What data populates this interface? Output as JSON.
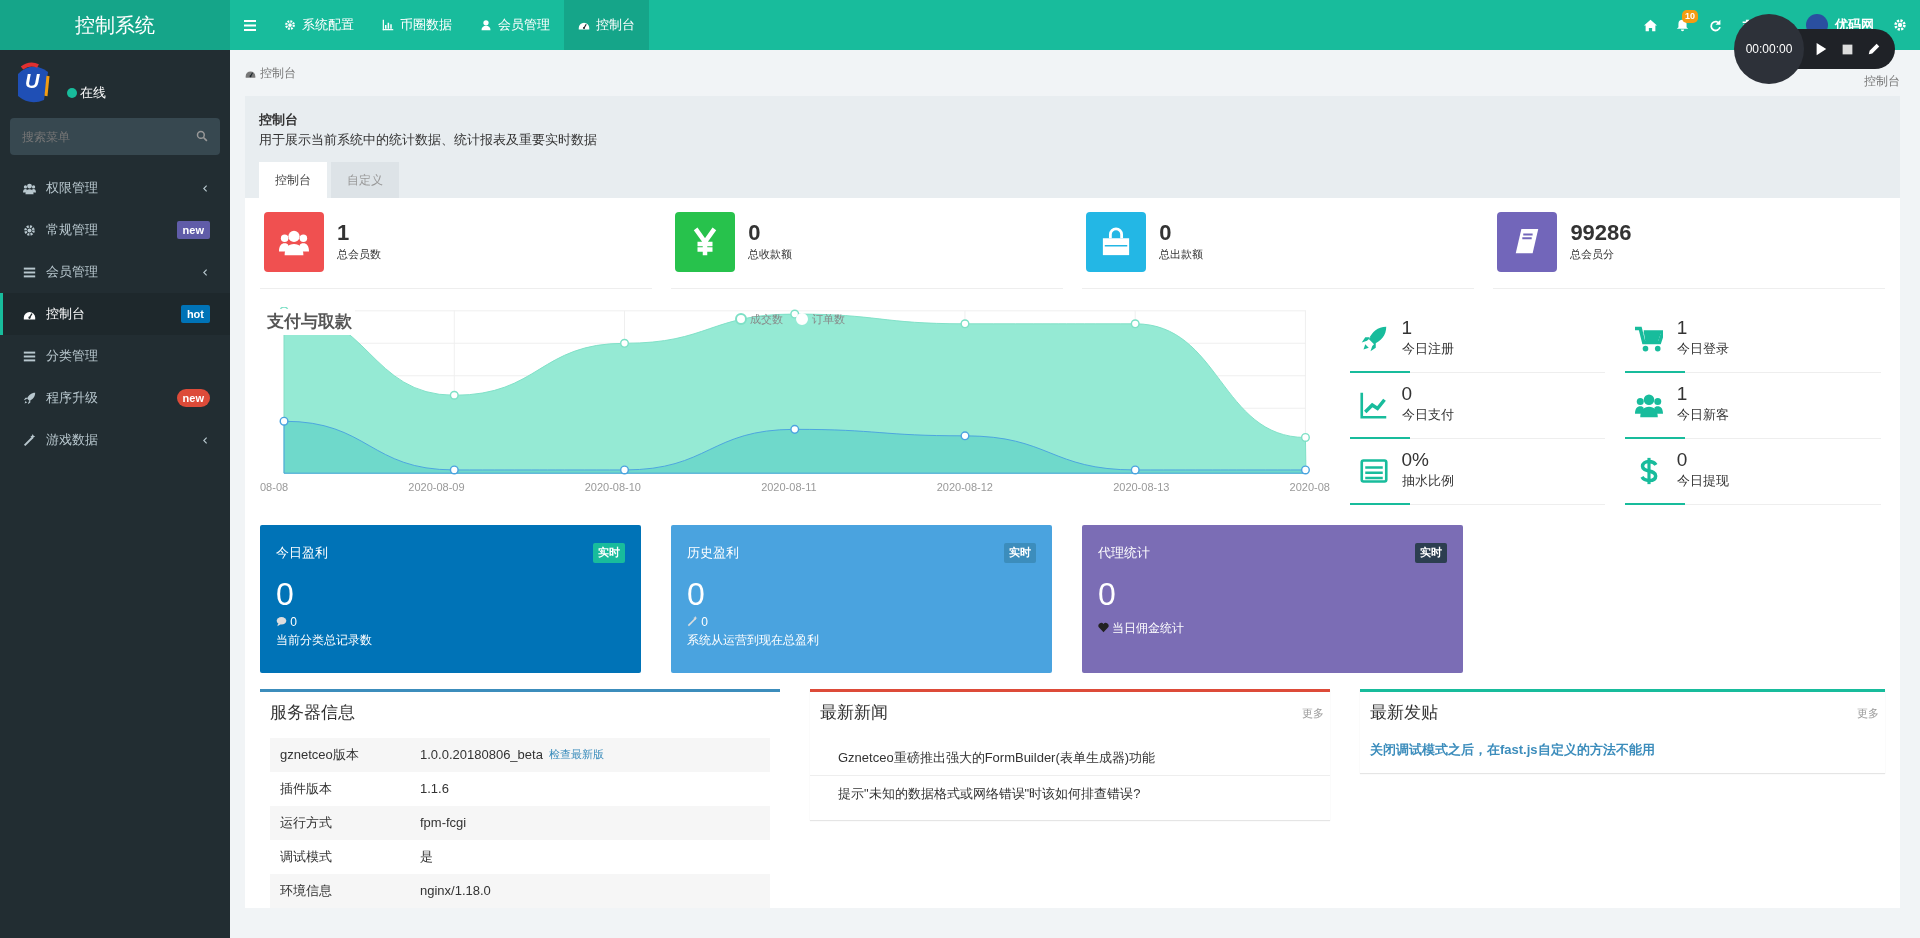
{
  "brand": "控制系统",
  "topnav": [
    {
      "label": "系统配置",
      "selected": false
    },
    {
      "label": "币圈数据",
      "selected": false
    },
    {
      "label": "会员管理",
      "selected": false
    },
    {
      "label": "控制台",
      "selected": true
    }
  ],
  "notification_count": "10",
  "user_name": "优码网",
  "recorder": {
    "time": "00:00:00"
  },
  "logo": {
    "letter": "U"
  },
  "user_status": "在线",
  "search": {
    "placeholder": "搜索菜单"
  },
  "sidebar": [
    {
      "label": "权限管理",
      "caret": true,
      "selected": false
    },
    {
      "label": "常规管理",
      "caret": false,
      "selected": false,
      "badge": {
        "text": "new",
        "kind": "label",
        "color": "#605ca8"
      }
    },
    {
      "label": "会员管理",
      "caret": true,
      "selected": false
    },
    {
      "label": "控制台",
      "caret": false,
      "selected": true,
      "badge": {
        "text": "hot",
        "kind": "label",
        "color": "#0073b7"
      }
    },
    {
      "label": "分类管理",
      "caret": false,
      "selected": false
    },
    {
      "label": "程序升级",
      "caret": false,
      "selected": false,
      "badge": {
        "text": "new",
        "kind": "pill",
        "color": "#dd4b39"
      }
    },
    {
      "label": "游戏数据",
      "caret": true,
      "selected": false
    }
  ],
  "breadcrumb": {
    "left": "控制台",
    "right": "控制台"
  },
  "header": {
    "title": "控制台",
    "description": "用于展示当前系统中的统计数据、统计报表及重要实时数据"
  },
  "tabs": [
    {
      "label": "控制台",
      "selected": true
    },
    {
      "label": "自定义",
      "selected": false
    }
  ],
  "stats": [
    {
      "value": "1",
      "label": "总会员数",
      "color": "#f05050"
    },
    {
      "value": "0",
      "label": "总收款额",
      "color": "#27c24c"
    },
    {
      "value": "0",
      "label": "总出款额",
      "color": "#23b7e5"
    },
    {
      "value": "99286",
      "label": "总会员分",
      "color": "#7266ba"
    }
  ],
  "chart": {
    "title": "支付与取款",
    "legend": [
      "成交数",
      "订单数"
    ],
    "x_labels": [
      "08-08",
      "2020-08-09",
      "2020-08-10",
      "2020-08-11",
      "2020-08-12",
      "2020-08-13",
      "2020-08"
    ]
  },
  "mini_stats": [
    {
      "value": "1",
      "label": "今日注册"
    },
    {
      "value": "1",
      "label": "今日登录"
    },
    {
      "value": "0",
      "label": "今日支付"
    },
    {
      "value": "1",
      "label": "今日新客"
    },
    {
      "value": "0%",
      "label": "抽水比例"
    },
    {
      "value": "0",
      "label": "今日提现"
    }
  ],
  "boxes": [
    {
      "title": "今日盈利",
      "tag": {
        "text": "实时",
        "color": "#18bc9c"
      },
      "value": "0",
      "sub_value": "0",
      "footer": "当前分类总记录数",
      "color": "#0073b7"
    },
    {
      "title": "历史盈利",
      "tag": {
        "text": "实时",
        "color": "#3c8dbc"
      },
      "value": "0",
      "sub_value": "0",
      "footer": "系统从运营到现在总盈利",
      "color": "#4aa3df"
    },
    {
      "title": "代理统计",
      "tag": {
        "text": "实时",
        "color": "#2c3e50"
      },
      "value": "0",
      "footer": "当日佣金统计",
      "color": "#7b6db5"
    }
  ],
  "server_info": {
    "title": "服务器信息",
    "rows": [
      {
        "key": "gznetceo版本",
        "value": "1.0.0.20180806_beta",
        "link": "检查最新版"
      },
      {
        "key": "插件版本",
        "value": "1.1.6"
      },
      {
        "key": "运行方式",
        "value": "fpm-fcgi"
      },
      {
        "key": "调试模式",
        "value": "是"
      },
      {
        "key": "环境信息",
        "value": "nginx/1.18.0"
      }
    ]
  },
  "news": {
    "title": "最新新闻",
    "more": "更多",
    "items": [
      "Gznetceo重磅推出强大的FormBuilder(表单生成器)功能",
      "提示\"未知的数据格式或网络错误\"时该如何排查错误?"
    ]
  },
  "posts": {
    "title": "最新发贴",
    "more": "更多",
    "items": [
      "关闭调试模式之后，在fast.js自定义的方法不能用"
    ]
  }
}
